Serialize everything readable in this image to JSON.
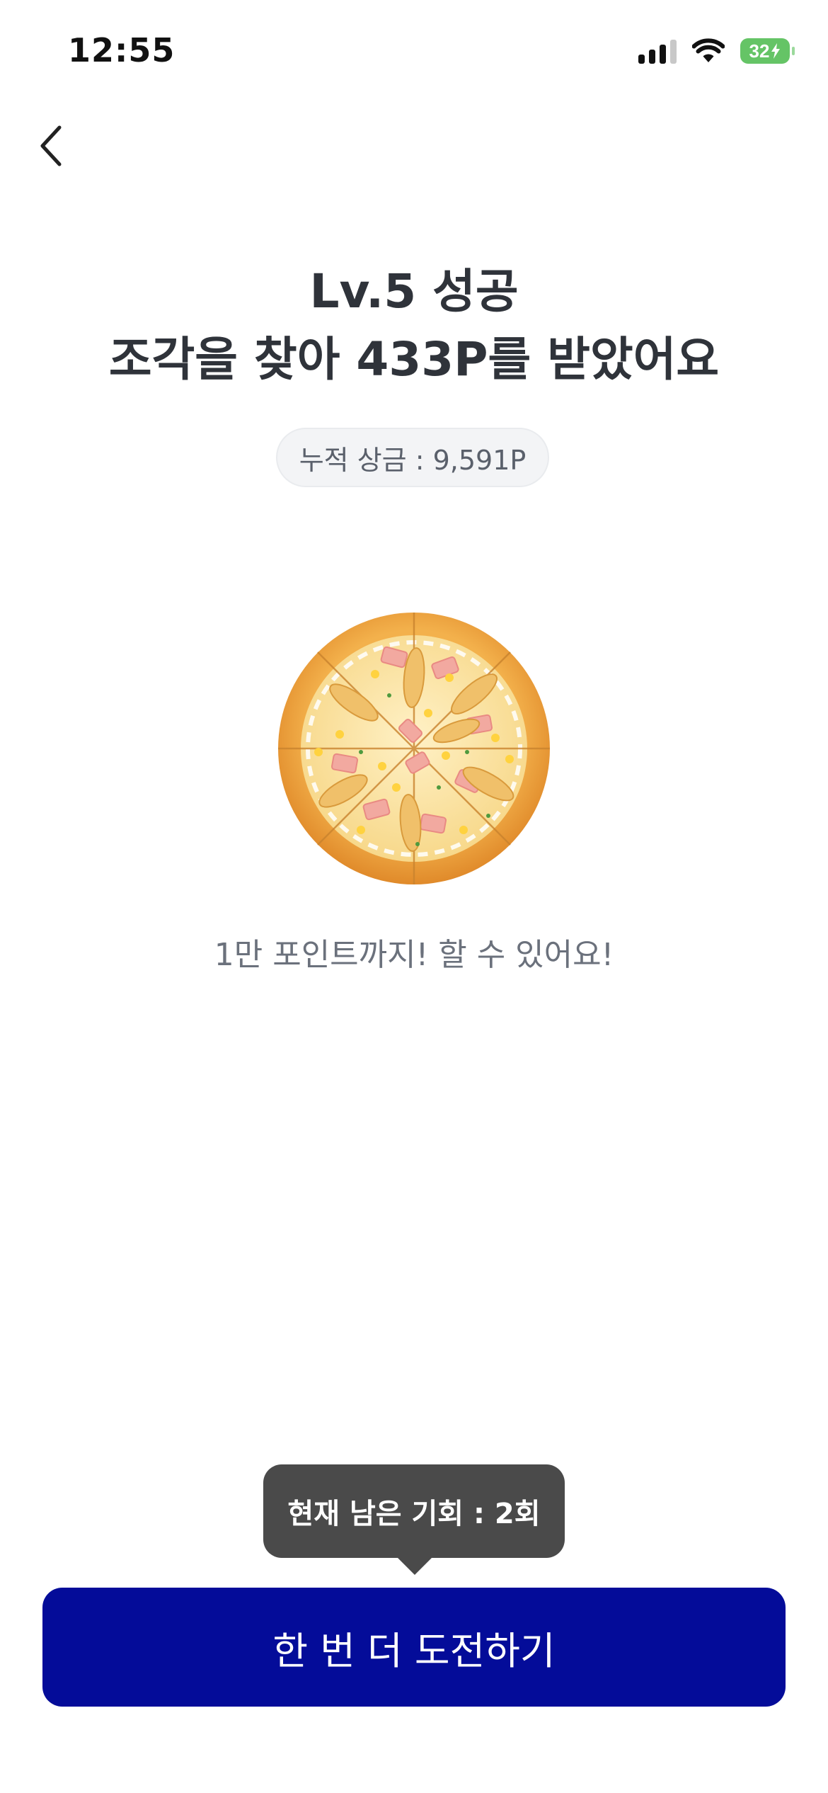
{
  "status_bar": {
    "time": "12:55",
    "battery": "32",
    "icons": [
      "cellular-signal-icon",
      "wifi-icon",
      "battery-charging-icon"
    ]
  },
  "nav": {
    "back_icon": "chevron-left-icon"
  },
  "result": {
    "title_line1": "Lv.5 성공",
    "title_line2": "조각을 찾아 433P를 받았어요",
    "accumulated_prize": "누적 상금 : 9,591P",
    "image": "pizza",
    "encouragement": "1만 포인트까지! 할 수 있어요!"
  },
  "footer": {
    "remaining_tooltip": "현재 남은 기회 : 2회",
    "retry_button_label": "한 번 더 도전하기"
  },
  "colors": {
    "primary_button": "#040c99",
    "tooltip_bg": "#4a4a4a",
    "chip_bg": "#f3f4f6",
    "battery": "#65c466"
  }
}
